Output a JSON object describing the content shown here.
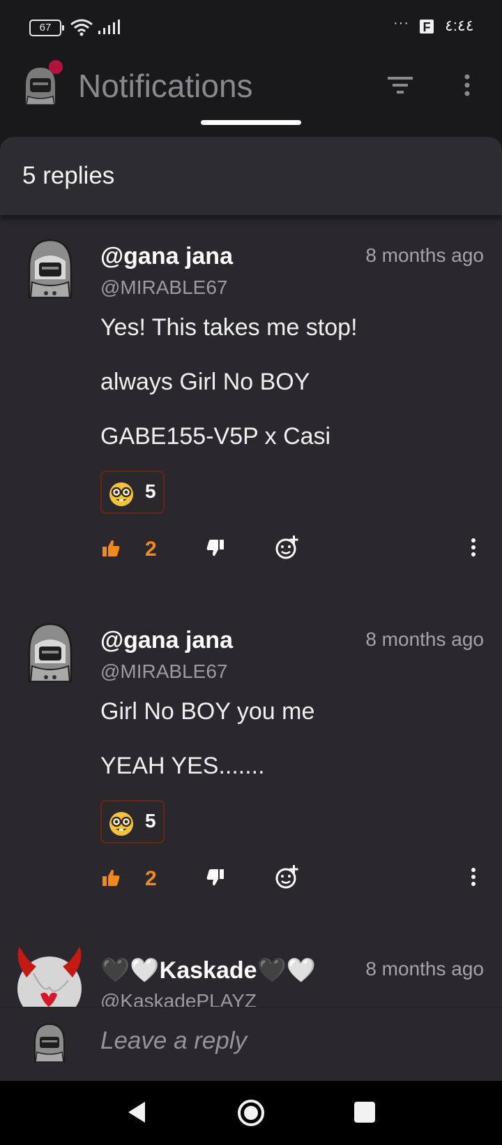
{
  "status_bar": {
    "battery": "67",
    "time": "٤:٤٤",
    "overflow": "···",
    "app_icon": "F"
  },
  "app_bar": {
    "title": "Notifications"
  },
  "sheet": {
    "title": "5 replies"
  },
  "comments": [
    {
      "name": "@gana jana",
      "handle": "@MIRABLE67",
      "time": "8 months ago",
      "lines": [
        "Yes! This takes me stop!",
        "always Girl No BOY",
        "GABE155-V5P x Casi"
      ],
      "reaction": {
        "emoji": "nerd-face",
        "count": "5"
      },
      "likes": "2"
    },
    {
      "name": "@gana jana",
      "handle": "@MIRABLE67",
      "time": "8 months ago",
      "lines": [
        "Girl No BOY you me",
        "YEAH YES......."
      ],
      "reaction": {
        "emoji": "nerd-face",
        "count": "5"
      },
      "likes": "2"
    },
    {
      "name": "🖤🤍Kaskade🖤🤍",
      "handle": "@KaskadePLAYZ",
      "time": "8 months ago"
    }
  ],
  "reply": {
    "placeholder": "Leave a reply"
  },
  "colors": {
    "accent": "#f08a1c",
    "background": "#2a282d",
    "notification_dot": "#b0143c"
  },
  "icons": [
    "filter-icon",
    "more-vert-icon",
    "thumbs-up-icon",
    "thumbs-down-icon",
    "add-reaction-icon",
    "back-icon",
    "home-icon",
    "recents-icon"
  ]
}
